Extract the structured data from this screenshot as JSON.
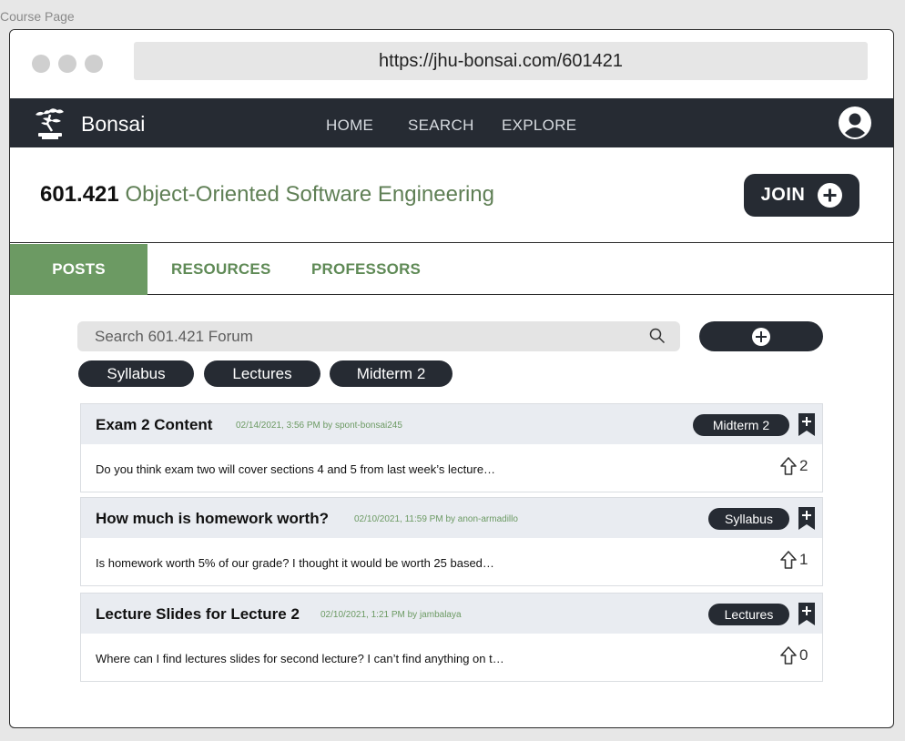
{
  "frame_label": "Course Page",
  "browser": {
    "url": "https://jhu-bonsai.com/601421"
  },
  "navbar": {
    "brand": "Bonsai",
    "links": {
      "home": "HOME",
      "search": "SEARCH",
      "explore": "EXPLORE"
    },
    "logo_icon": "bonsai-tree-icon",
    "avatar_icon": "user-avatar-icon"
  },
  "course": {
    "code": "601.421",
    "name": "Object-Oriented Software Engineering",
    "join_label": "JOIN"
  },
  "tabs": {
    "posts": "POSTS",
    "resources": "RESOURCES",
    "professors": "PROFESSORS",
    "active": "POSTS"
  },
  "forum": {
    "search_placeholder": "Search 601.421 Forum",
    "tag_filters": [
      "Syllabus",
      "Lectures",
      "Midterm 2"
    ],
    "posts": [
      {
        "title": "Exam 2 Content",
        "meta": "02/14/2021, 3:56 PM by spont-bonsai245",
        "tag": "Midterm 2",
        "preview": "Do you think exam two will cover sections 4 and 5 from last week’s lecture…",
        "votes": "2"
      },
      {
        "title": "How much is homework worth?",
        "meta": "02/10/2021, 11:59 PM by anon-armadillo",
        "tag": "Syllabus",
        "preview": "Is homework worth 5% of our grade? I thought it would be worth 25 based…",
        "votes": "1"
      },
      {
        "title": "Lecture Slides for Lecture 2",
        "meta": "02/10/2021, 1:21 PM by jambalaya",
        "tag": "Lectures",
        "preview": "Where can I find lectures slides for second lecture? I can’t find anything on t…",
        "votes": "0"
      }
    ]
  },
  "colors": {
    "dark": "#262b33",
    "accent_green": "#6c9a63",
    "title_green": "#5f7f55",
    "post_header_bg": "#e9ecf1"
  }
}
